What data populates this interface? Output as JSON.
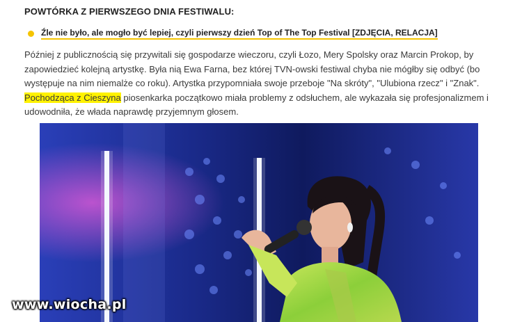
{
  "section": {
    "heading": "POWTÓRKA Z PIERWSZEGO DNIA FESTIWALU:"
  },
  "related": {
    "link_text": "Źle nie było, ale mogło być lepiej, czyli pierwszy dzień Top of The Top Festival [ZDJĘCIA, RELACJA]",
    "bullet_color": "#f5c400"
  },
  "article": {
    "line1": "Później z publicznością się przywitali się gospodarze wieczoru, czyli Łozo, Mery Spolsky oraz Marcin Prokop, by",
    "line2": "zapowiedzieć kolejną artystkę. Była nią Ewa Farna, bez której TVN-owski festiwal chyba nie mógłby się odbyć (bo",
    "line3": "występuje na nim niemalże co roku). Artystka przypomniała swoje przeboje \"Na skróty\", \"Ulubiona rzecz\" i \"Znak\".",
    "highlight": "Pochodząca z Cieszyna",
    "line4_rest": " piosenkarka początkowo miała problemy z odsłuchem, ale wykazała się profesjonalizmem i",
    "line5": "udowodniła, że włada naprawdę przyjemnym głosem.",
    "highlight_color": "#fff200"
  },
  "photo": {
    "subject": "singer-on-stage"
  },
  "watermark": {
    "text": "www.wiocha.pl"
  }
}
